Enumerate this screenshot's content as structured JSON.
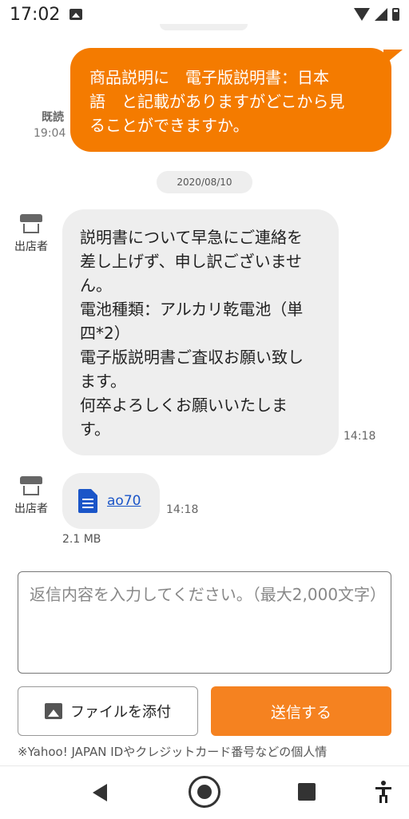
{
  "status_bar": {
    "time": "17:02"
  },
  "outgoing_message": {
    "text": "商品説明に　電子版説明書：日本\n語　と記載がありますがどこから見\nることができますか。",
    "read_label": "既読",
    "time": "19:04",
    "color": "#f47b00"
  },
  "date_chip": "2020/08/10",
  "shop_label": "出店者",
  "incoming_message": {
    "text": "説明書について早急にご連絡を\n差し上げず、申し訳ございませ\nん。\n電池種類：アルカリ乾電池（単\n四*2）\n電子版説明書ご査収お願い致し\nます。\n何卒よろしくお願いいたしま\nす。",
    "time": "14:18"
  },
  "attachment": {
    "name": "ao70",
    "time": "14:18",
    "size": "2.1 MB"
  },
  "reply": {
    "placeholder": "返信内容を入力してください。（最大2,000文字）"
  },
  "buttons": {
    "attach_label": "ファイルを添付",
    "send_label": "送信する",
    "send_color": "#f58220"
  },
  "notice": "※Yahoo! JAPAN IDやクレジットカード番号などの個人情"
}
